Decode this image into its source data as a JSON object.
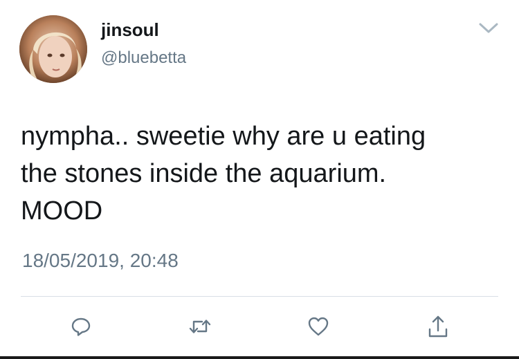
{
  "user": {
    "display_name": "jinsoul",
    "handle": "@bluebetta"
  },
  "tweet": {
    "text": "nympha.. sweetie why are u eating\nthe stones inside the aquarium.\nMOOD",
    "timestamp": "18/05/2019, 20:48"
  },
  "icons": {
    "menu": "chevron-down-icon",
    "reply": "reply-icon",
    "retweet": "retweet-icon",
    "like": "heart-icon",
    "share": "share-icon"
  },
  "colors": {
    "primary_text": "#14171a",
    "secondary_text": "#657786",
    "icon": "#657786",
    "divider": "#d8dfe5"
  }
}
